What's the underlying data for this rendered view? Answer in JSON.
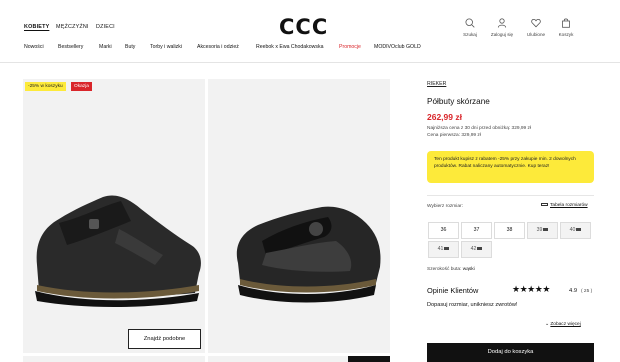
{
  "header": {
    "gender_tabs": [
      "KOBIETY",
      "MĘŻCZYŹNI",
      "DZIECI"
    ],
    "logo": "CCC",
    "icons": [
      {
        "icon": "search-icon",
        "label": "Szukaj"
      },
      {
        "icon": "user-icon",
        "label": "Zaloguj się"
      },
      {
        "icon": "heart-icon",
        "label": "Ulubione"
      },
      {
        "icon": "bag-icon",
        "label": "Koszyk"
      }
    ],
    "categories": [
      "Nowości",
      "Bestsellery",
      "Marki",
      "Buty",
      "Torby i walizki",
      "Akcesoria i odzież",
      "Reebok x Ewa Chodakowska",
      "Promocje",
      "MODIVOclub GOLD"
    ]
  },
  "gallery": {
    "badges": [
      "-25% w koszyku",
      "Okazja"
    ],
    "find_similar": "Znajdź podobne"
  },
  "product": {
    "brand": "RIEKER",
    "name": "Półbuty skórzane",
    "price": "262,99 zł",
    "lowest_price": "Najniższa cena z 30 dni przed obniżką: 329,99 zł",
    "first_price": "Cena pierwsza: 329,99 zł",
    "promo_text": "Ten produkt kupisz z rabatem -25% przy zakupie min. 2 dowolnych produktów. Rabat naliczany automatycznie. Kup teraz!",
    "choose_size": "Wybierz rozmiar:",
    "size_table": "Tabela rozmiarów",
    "sizes": [
      "36",
      "37",
      "38",
      "39",
      "40",
      "41",
      "42"
    ],
    "width_label": "Szerokość buta:",
    "width_value": "wąski",
    "reviews_title": "Opinie Klientów",
    "rating": "4.9",
    "review_count": "( 25 )",
    "fit_text": "Dopasuj rozmiar, unikniesz zwrotów!",
    "see_more": "Zobacz więcej",
    "add_to_cart": "Dodaj do koszyka"
  },
  "colors": {
    "accent": "#d9252a",
    "promo_bg": "#fdea3a",
    "button": "#111111"
  }
}
